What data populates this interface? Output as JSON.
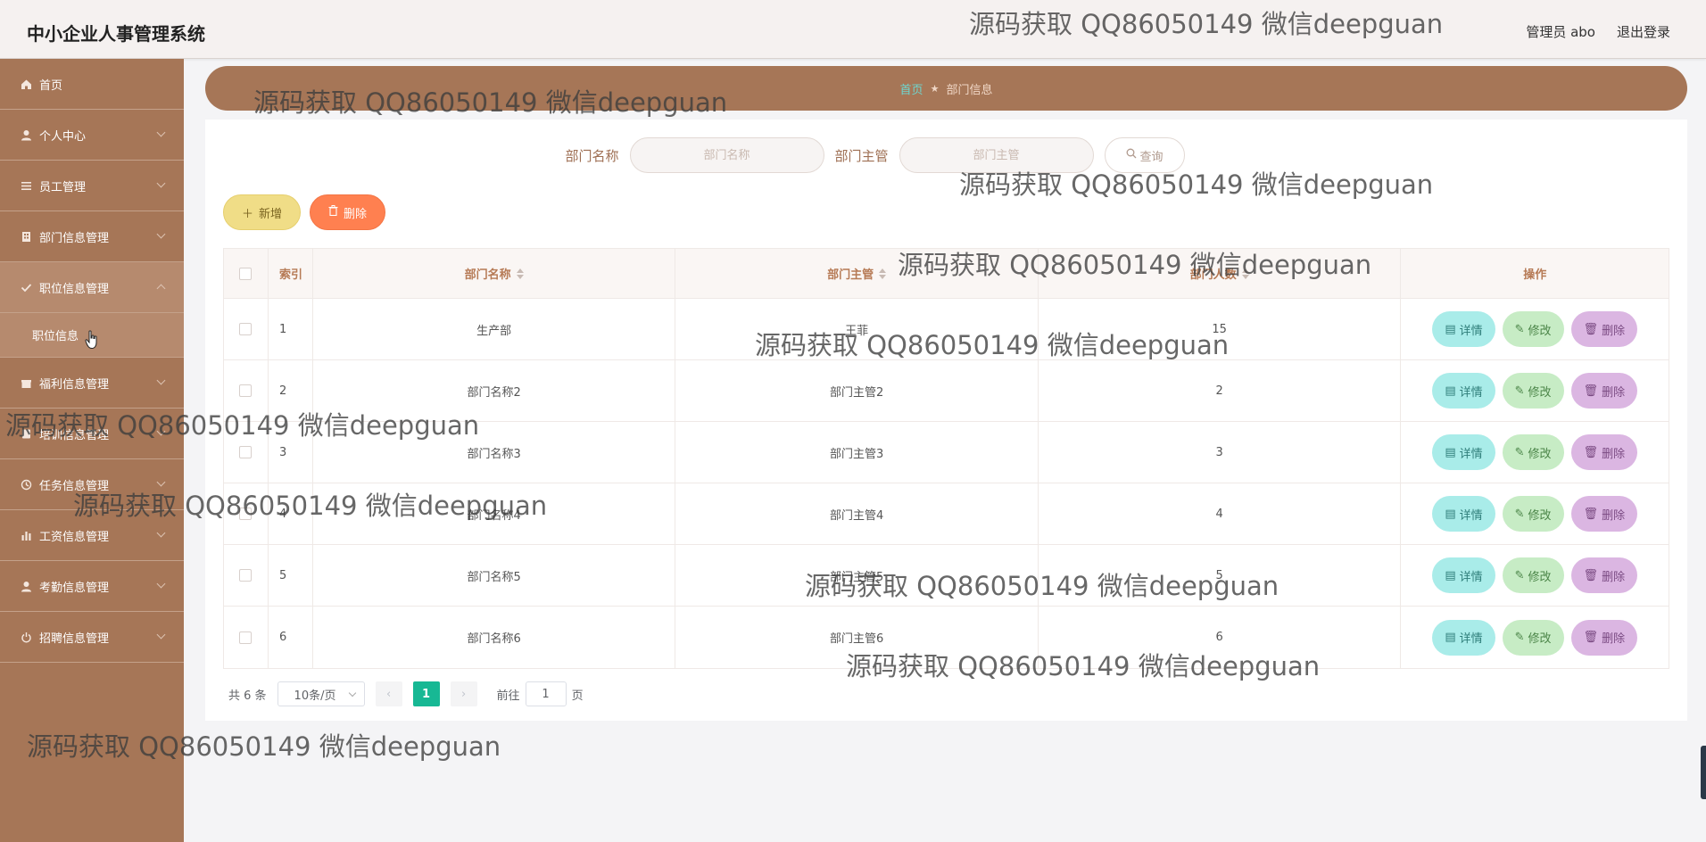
{
  "header": {
    "title": "中小企业人事管理系统",
    "user": "管理员 abo",
    "logout": "退出登录"
  },
  "sidebar": {
    "items": [
      {
        "label": "首页",
        "icon": "home-icon"
      },
      {
        "label": "个人中心",
        "icon": "user-icon"
      },
      {
        "label": "员工管理",
        "icon": "list-icon"
      },
      {
        "label": "部门信息管理",
        "icon": "building-icon"
      },
      {
        "label": "职位信息管理",
        "icon": "check-icon"
      },
      {
        "label": "福利信息管理",
        "icon": "gift-icon"
      },
      {
        "label": "培训信息管理",
        "icon": "book-icon"
      },
      {
        "label": "任务信息管理",
        "icon": "clock-icon"
      },
      {
        "label": "工资信息管理",
        "icon": "chart-icon"
      },
      {
        "label": "考勤信息管理",
        "icon": "user-icon"
      },
      {
        "label": "招聘信息管理",
        "icon": "power-icon"
      }
    ],
    "sub_item": "职位信息"
  },
  "breadcrumb": {
    "home": "首页",
    "current": "部门信息"
  },
  "search": {
    "name_label": "部门名称",
    "name_placeholder": "部门名称",
    "manager_label": "部门主管",
    "manager_placeholder": "部门主管",
    "query_button": "查询"
  },
  "actions": {
    "add": "新增",
    "delete": "删除"
  },
  "table": {
    "headers": {
      "index": "索引",
      "name": "部门名称",
      "manager": "部门主管",
      "count": "部门人数",
      "ops": "操作"
    },
    "rows": [
      {
        "index": "1",
        "name": "生产部",
        "manager": "王菲",
        "count": "15"
      },
      {
        "index": "2",
        "name": "部门名称2",
        "manager": "部门主管2",
        "count": "2"
      },
      {
        "index": "3",
        "name": "部门名称3",
        "manager": "部门主管3",
        "count": "3"
      },
      {
        "index": "4",
        "name": "部门名称4",
        "manager": "部门主管4",
        "count": "4"
      },
      {
        "index": "5",
        "name": "部门名称5",
        "manager": "部门主管5",
        "count": "5"
      },
      {
        "index": "6",
        "name": "部门名称6",
        "manager": "部门主管6",
        "count": "6"
      }
    ],
    "ops": {
      "detail": "详情",
      "edit": "修改",
      "remove": "删除"
    }
  },
  "pagination": {
    "total": "共 6 条",
    "page_size": "10条/页",
    "current_page": "1",
    "goto_prefix": "前往",
    "goto_value": "1",
    "goto_suffix": "页"
  },
  "watermark": "源码获取 QQ86050149 微信deepguan",
  "colors": {
    "brand_brown": "#a67657",
    "accent_teal": "#17b894",
    "add_yellow": "#f0dd87",
    "delete_orange": "#ff8050"
  }
}
